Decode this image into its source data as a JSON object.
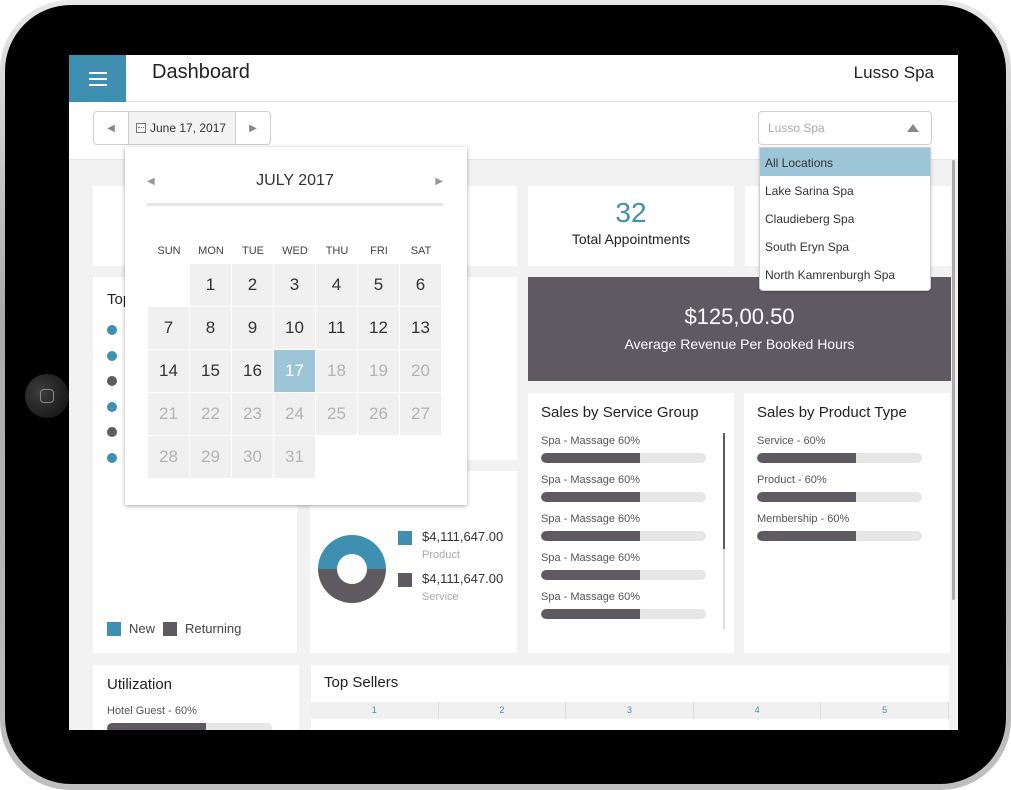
{
  "header": {
    "title": "Dashboard",
    "brand": "Lusso Spa",
    "menu_icon": "hamburger-icon"
  },
  "toolbar": {
    "date": "June 17, 2017",
    "prev_icon": "triangle-left-icon",
    "next_icon": "triangle-right-icon",
    "calendar_icon": "calendar-icon",
    "location_placeholder": "Lusso Spa"
  },
  "location_menu": {
    "options": [
      "All Locations",
      "Lake Sarina Spa",
      "Claudieberg Spa",
      "South Eryn Spa",
      "North Kamrenburgh Spa"
    ],
    "highlighted": "All Locations"
  },
  "calendar": {
    "month_label": "JULY 2017",
    "weekdays": [
      "SUN",
      "MON",
      "TUE",
      "WED",
      "THU",
      "FRI",
      "SAT"
    ],
    "first_weekday_index": 6,
    "days_in_month": 31,
    "selected_day": 17,
    "note": "days after selected are shown muted"
  },
  "stats": {
    "total_appointments": {
      "value": "32",
      "label": "Total Appointments"
    },
    "avg_revenue": {
      "value": "$125,00.50",
      "label": "Average Revenue Per Booked Hours"
    }
  },
  "top_card": {
    "title": "Top",
    "dots": [
      "new",
      "new",
      "returning",
      "new",
      "returning",
      "new"
    ],
    "legend": [
      {
        "label": "New",
        "color": "#3f8fb0"
      },
      {
        "label": "Returning",
        "color": "#5f5a62"
      }
    ]
  },
  "revenue_split": {
    "items": [
      {
        "amount": "$4,111,647.00",
        "category": "Product",
        "color": "#3f8fb0",
        "share": 50
      },
      {
        "amount": "$4,111,647.00",
        "category": "Service",
        "color": "#5f5a62",
        "share": 50
      }
    ]
  },
  "sales_by_service_group": {
    "title": "Sales by Service Group",
    "items": [
      {
        "label": "Spa - Massage 60%",
        "percent": 60
      },
      {
        "label": "Spa - Massage 60%",
        "percent": 60
      },
      {
        "label": "Spa - Massage 60%",
        "percent": 60
      },
      {
        "label": "Spa - Massage 60%",
        "percent": 60
      },
      {
        "label": "Spa - Massage 60%",
        "percent": 60
      }
    ]
  },
  "sales_by_product_type": {
    "title": "Sales by Product Type",
    "items": [
      {
        "label": "Service - 60%",
        "percent": 60
      },
      {
        "label": "Product - 60%",
        "percent": 60
      },
      {
        "label": "Membership - 60%",
        "percent": 60
      }
    ]
  },
  "utilization": {
    "title": "Utilization",
    "items": [
      {
        "label": "Hotel Guest - 60%",
        "percent": 60
      }
    ]
  },
  "top_sellers": {
    "title": "Top Sellers",
    "columns": [
      "1",
      "2",
      "3",
      "4",
      "5"
    ]
  },
  "colors": {
    "accent": "#3f8fb0",
    "dark": "#5f5a62",
    "selected": "#9cc5d8"
  }
}
